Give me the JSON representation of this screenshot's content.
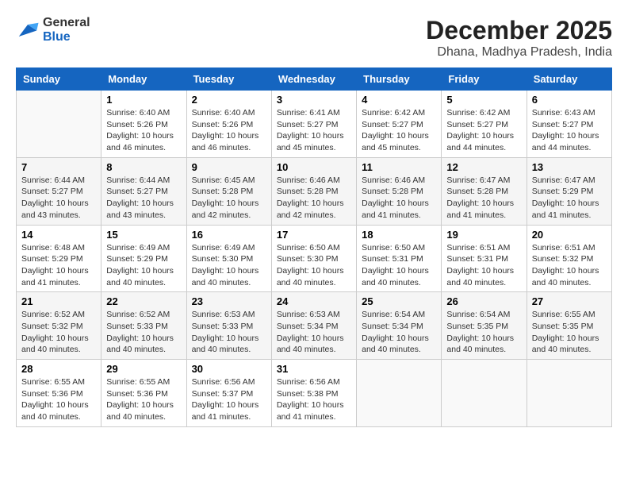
{
  "header": {
    "logo_line1": "General",
    "logo_line2": "Blue",
    "title": "December 2025",
    "subtitle": "Dhana, Madhya Pradesh, India"
  },
  "days_of_week": [
    "Sunday",
    "Monday",
    "Tuesday",
    "Wednesday",
    "Thursday",
    "Friday",
    "Saturday"
  ],
  "weeks": [
    [
      {
        "day": "",
        "info": ""
      },
      {
        "day": "1",
        "info": "Sunrise: 6:40 AM\nSunset: 5:26 PM\nDaylight: 10 hours\nand 46 minutes."
      },
      {
        "day": "2",
        "info": "Sunrise: 6:40 AM\nSunset: 5:26 PM\nDaylight: 10 hours\nand 46 minutes."
      },
      {
        "day": "3",
        "info": "Sunrise: 6:41 AM\nSunset: 5:27 PM\nDaylight: 10 hours\nand 45 minutes."
      },
      {
        "day": "4",
        "info": "Sunrise: 6:42 AM\nSunset: 5:27 PM\nDaylight: 10 hours\nand 45 minutes."
      },
      {
        "day": "5",
        "info": "Sunrise: 6:42 AM\nSunset: 5:27 PM\nDaylight: 10 hours\nand 44 minutes."
      },
      {
        "day": "6",
        "info": "Sunrise: 6:43 AM\nSunset: 5:27 PM\nDaylight: 10 hours\nand 44 minutes."
      }
    ],
    [
      {
        "day": "7",
        "info": "Sunrise: 6:44 AM\nSunset: 5:27 PM\nDaylight: 10 hours\nand 43 minutes."
      },
      {
        "day": "8",
        "info": "Sunrise: 6:44 AM\nSunset: 5:27 PM\nDaylight: 10 hours\nand 43 minutes."
      },
      {
        "day": "9",
        "info": "Sunrise: 6:45 AM\nSunset: 5:28 PM\nDaylight: 10 hours\nand 42 minutes."
      },
      {
        "day": "10",
        "info": "Sunrise: 6:46 AM\nSunset: 5:28 PM\nDaylight: 10 hours\nand 42 minutes."
      },
      {
        "day": "11",
        "info": "Sunrise: 6:46 AM\nSunset: 5:28 PM\nDaylight: 10 hours\nand 41 minutes."
      },
      {
        "day": "12",
        "info": "Sunrise: 6:47 AM\nSunset: 5:28 PM\nDaylight: 10 hours\nand 41 minutes."
      },
      {
        "day": "13",
        "info": "Sunrise: 6:47 AM\nSunset: 5:29 PM\nDaylight: 10 hours\nand 41 minutes."
      }
    ],
    [
      {
        "day": "14",
        "info": "Sunrise: 6:48 AM\nSunset: 5:29 PM\nDaylight: 10 hours\nand 41 minutes."
      },
      {
        "day": "15",
        "info": "Sunrise: 6:49 AM\nSunset: 5:29 PM\nDaylight: 10 hours\nand 40 minutes."
      },
      {
        "day": "16",
        "info": "Sunrise: 6:49 AM\nSunset: 5:30 PM\nDaylight: 10 hours\nand 40 minutes."
      },
      {
        "day": "17",
        "info": "Sunrise: 6:50 AM\nSunset: 5:30 PM\nDaylight: 10 hours\nand 40 minutes."
      },
      {
        "day": "18",
        "info": "Sunrise: 6:50 AM\nSunset: 5:31 PM\nDaylight: 10 hours\nand 40 minutes."
      },
      {
        "day": "19",
        "info": "Sunrise: 6:51 AM\nSunset: 5:31 PM\nDaylight: 10 hours\nand 40 minutes."
      },
      {
        "day": "20",
        "info": "Sunrise: 6:51 AM\nSunset: 5:32 PM\nDaylight: 10 hours\nand 40 minutes."
      }
    ],
    [
      {
        "day": "21",
        "info": "Sunrise: 6:52 AM\nSunset: 5:32 PM\nDaylight: 10 hours\nand 40 minutes."
      },
      {
        "day": "22",
        "info": "Sunrise: 6:52 AM\nSunset: 5:33 PM\nDaylight: 10 hours\nand 40 minutes."
      },
      {
        "day": "23",
        "info": "Sunrise: 6:53 AM\nSunset: 5:33 PM\nDaylight: 10 hours\nand 40 minutes."
      },
      {
        "day": "24",
        "info": "Sunrise: 6:53 AM\nSunset: 5:34 PM\nDaylight: 10 hours\nand 40 minutes."
      },
      {
        "day": "25",
        "info": "Sunrise: 6:54 AM\nSunset: 5:34 PM\nDaylight: 10 hours\nand 40 minutes."
      },
      {
        "day": "26",
        "info": "Sunrise: 6:54 AM\nSunset: 5:35 PM\nDaylight: 10 hours\nand 40 minutes."
      },
      {
        "day": "27",
        "info": "Sunrise: 6:55 AM\nSunset: 5:35 PM\nDaylight: 10 hours\nand 40 minutes."
      }
    ],
    [
      {
        "day": "28",
        "info": "Sunrise: 6:55 AM\nSunset: 5:36 PM\nDaylight: 10 hours\nand 40 minutes."
      },
      {
        "day": "29",
        "info": "Sunrise: 6:55 AM\nSunset: 5:36 PM\nDaylight: 10 hours\nand 40 minutes."
      },
      {
        "day": "30",
        "info": "Sunrise: 6:56 AM\nSunset: 5:37 PM\nDaylight: 10 hours\nand 41 minutes."
      },
      {
        "day": "31",
        "info": "Sunrise: 6:56 AM\nSunset: 5:38 PM\nDaylight: 10 hours\nand 41 minutes."
      },
      {
        "day": "",
        "info": ""
      },
      {
        "day": "",
        "info": ""
      },
      {
        "day": "",
        "info": ""
      }
    ]
  ]
}
